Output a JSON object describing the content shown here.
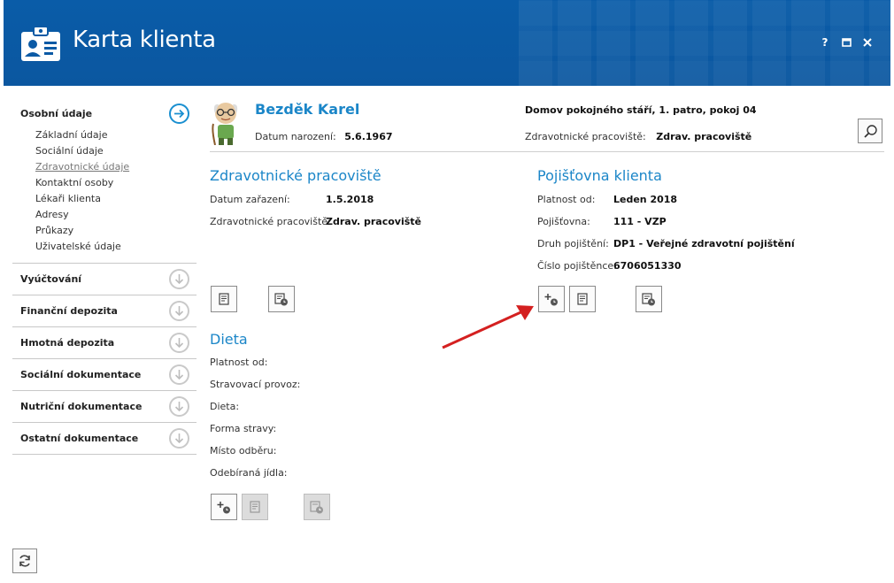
{
  "header": {
    "title": "Karta klienta",
    "help": "?",
    "maximize": "▣",
    "close": "✕",
    "brand_color": "#0b5aa5"
  },
  "sidebar": {
    "sections": [
      {
        "label": "Osobní údaje",
        "expanded": true
      },
      {
        "label": "Vyúčtování"
      },
      {
        "label": "Finanční depozita"
      },
      {
        "label": "Hmotná depozita"
      },
      {
        "label": "Sociální dokumentace"
      },
      {
        "label": "Nutriční dokumentace"
      },
      {
        "label": "Ostatní dokumentace"
      }
    ],
    "subitems": [
      "Základní údaje",
      "Sociální údaje",
      "Zdravotnické údaje",
      "Kontaktní osoby",
      "Lékaři klienta",
      "Adresy",
      "Průkazy",
      "Uživatelské údaje"
    ],
    "active_subitem": "Zdravotnické údaje"
  },
  "client": {
    "name": "Bezděk Karel",
    "birth_label": "Datum narození:",
    "birth_value": "5.6.1967",
    "location": "Domov pokojného stáří, 1. patro, pokoj 04",
    "workplace_label": "Zdravotnické pracoviště:",
    "workplace_value": "Zdrav. pracoviště"
  },
  "health_workplace": {
    "title": "Zdravotnické pracoviště",
    "rows": [
      {
        "label": "Datum zařazení:",
        "value": "1.5.2018"
      },
      {
        "label": "Zdravotnické pracoviště:",
        "value": "Zdrav. pracoviště"
      }
    ]
  },
  "insurance": {
    "title": "Pojišťovna klienta",
    "rows": [
      {
        "label": "Platnost od:",
        "value": "Leden 2018"
      },
      {
        "label": "Pojišťovna:",
        "value": "111 - VZP"
      },
      {
        "label": "Druh pojištění:",
        "value": "DP1 - Veřejné zdravotní pojištění"
      },
      {
        "label": "Číslo pojištěnce:",
        "value": "6706051330"
      }
    ]
  },
  "diet": {
    "title": "Dieta",
    "rows": [
      {
        "label": "Platnost od:"
      },
      {
        "label": "Stravovací provoz:"
      },
      {
        "label": "Dieta:"
      },
      {
        "label": "Forma stravy:"
      },
      {
        "label": "Místo odběru:"
      },
      {
        "label": "Odebíraná jídla:"
      }
    ]
  },
  "colors": {
    "accent": "#1b86c8",
    "annotation_arrow": "#d42020"
  }
}
